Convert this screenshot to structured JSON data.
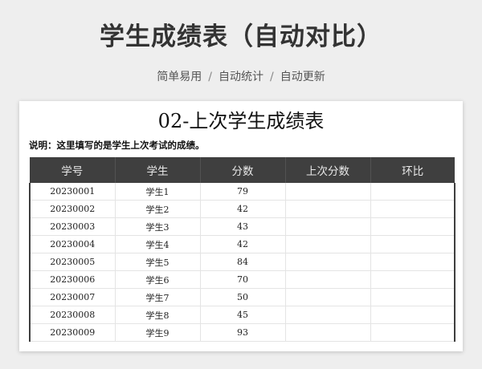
{
  "header": {
    "title": "学生成绩表（自动对比）",
    "tags": [
      "简单易用",
      "自动统计",
      "自动更新"
    ],
    "separator": "/"
  },
  "sheet": {
    "title": "02-上次学生成绩表",
    "note": "说明：这里填写的是学生上次考试的成绩。",
    "columns": [
      "学号",
      "学生",
      "分数",
      "上次分数",
      "环比"
    ],
    "rows": [
      {
        "id": "20230001",
        "name": "学生1",
        "score": "79",
        "last": "",
        "ratio": ""
      },
      {
        "id": "20230002",
        "name": "学生2",
        "score": "42",
        "last": "",
        "ratio": ""
      },
      {
        "id": "20230003",
        "name": "学生3",
        "score": "43",
        "last": "",
        "ratio": ""
      },
      {
        "id": "20230004",
        "name": "学生4",
        "score": "42",
        "last": "",
        "ratio": ""
      },
      {
        "id": "20230005",
        "name": "学生5",
        "score": "84",
        "last": "",
        "ratio": ""
      },
      {
        "id": "20230006",
        "name": "学生6",
        "score": "70",
        "last": "",
        "ratio": ""
      },
      {
        "id": "20230007",
        "name": "学生7",
        "score": "50",
        "last": "",
        "ratio": ""
      },
      {
        "id": "20230008",
        "name": "学生8",
        "score": "45",
        "last": "",
        "ratio": ""
      },
      {
        "id": "20230009",
        "name": "学生9",
        "score": "93",
        "last": "",
        "ratio": ""
      }
    ]
  }
}
